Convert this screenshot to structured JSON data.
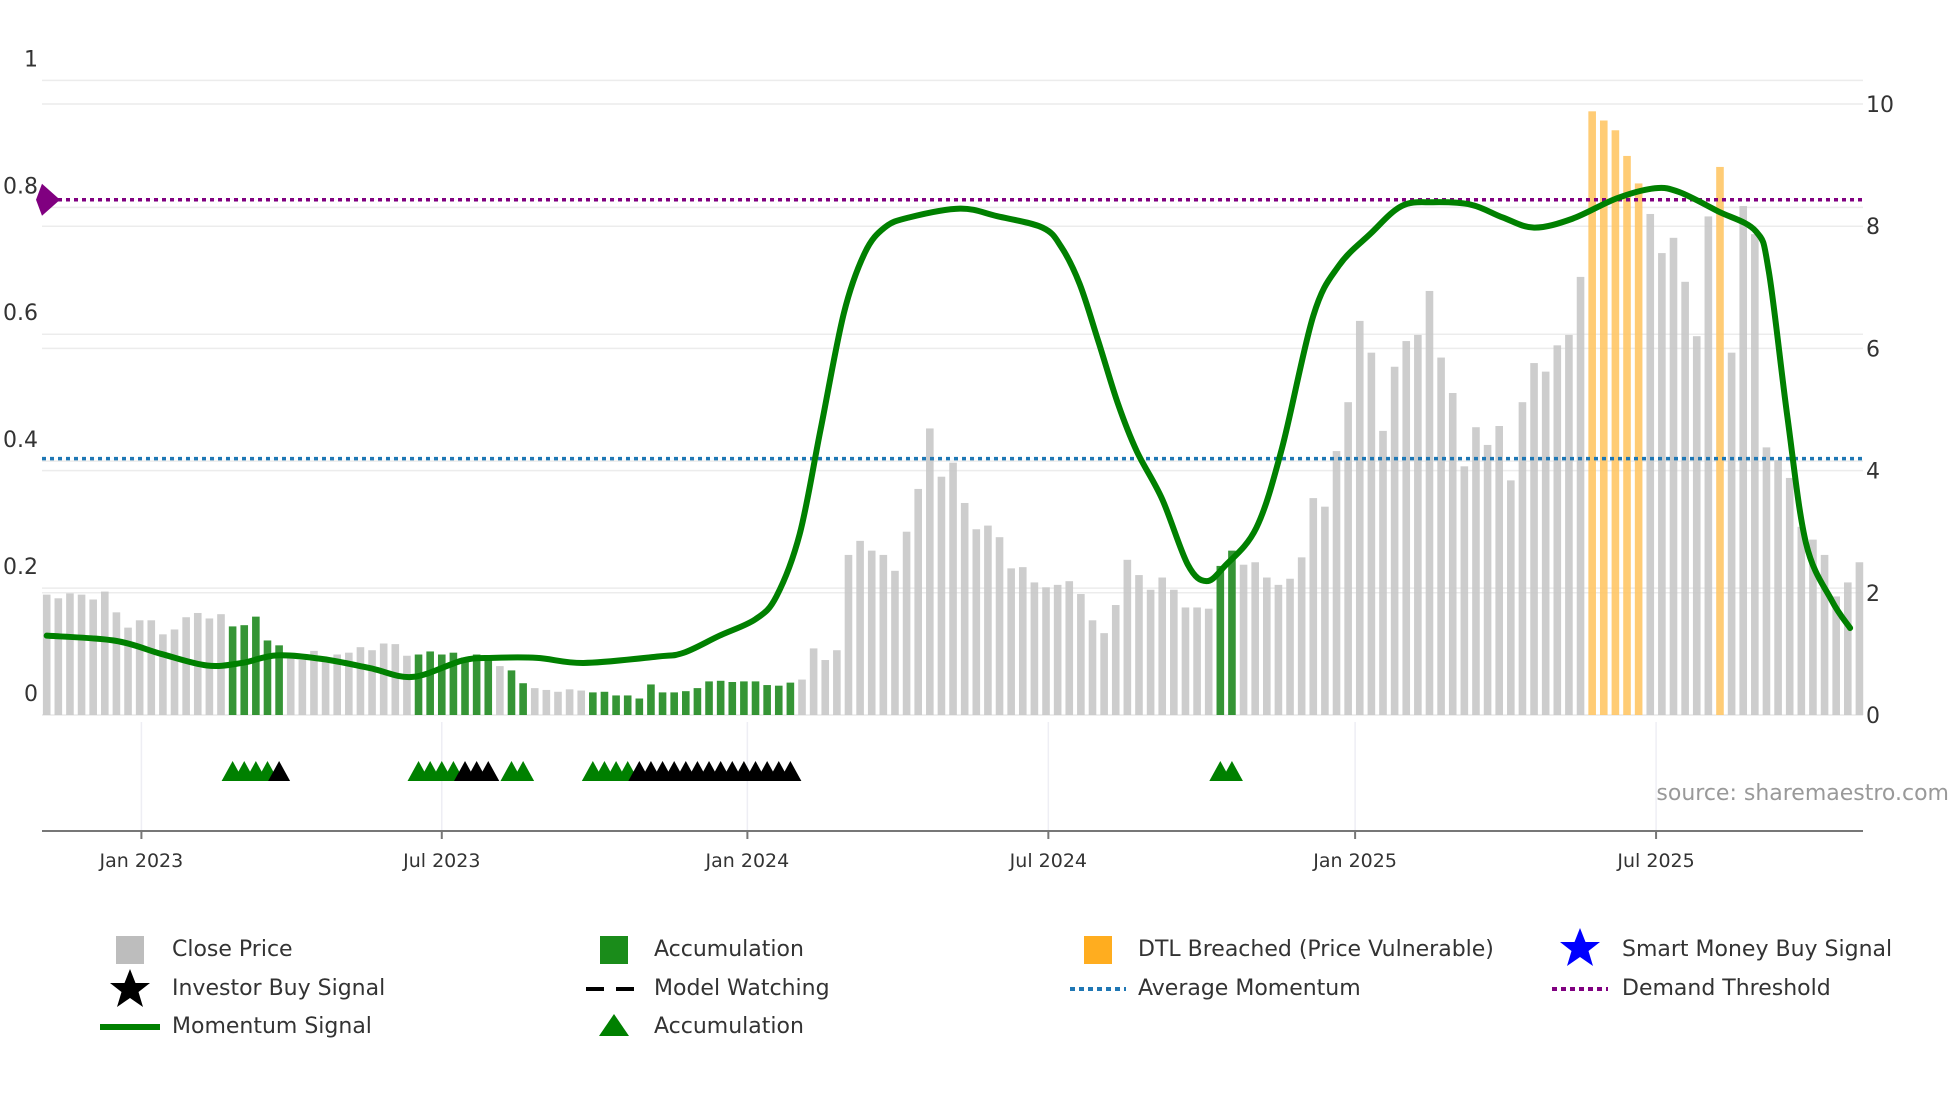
{
  "chart_data": {
    "type": "bar",
    "x_unit": "weekly bars, index 0 = week of 2022-11-07",
    "bars": {
      "name": "Close Price",
      "axis": "right",
      "values": [
        1.97,
        1.91,
        1.99,
        1.97,
        1.89,
        2.02,
        1.68,
        1.43,
        1.55,
        1.55,
        1.32,
        1.4,
        1.6,
        1.67,
        1.58,
        1.65,
        1.45,
        1.47,
        1.61,
        1.22,
        1.14,
        0.96,
        0.9,
        1.05,
        0.93,
        0.99,
        1.02,
        1.11,
        1.06,
        1.17,
        1.16,
        0.97,
        0.99,
        1.04,
        0.99,
        1.02,
        0.94,
        0.99,
        0.94,
        0.8,
        0.73,
        0.52,
        0.44,
        0.41,
        0.38,
        0.42,
        0.4,
        0.37,
        0.38,
        0.32,
        0.32,
        0.27,
        0.5,
        0.37,
        0.37,
        0.39,
        0.44,
        0.55,
        0.56,
        0.54,
        0.55,
        0.55,
        0.49,
        0.48,
        0.53,
        0.58,
        1.09,
        0.9,
        1.06,
        2.62,
        2.85,
        2.69,
        2.62,
        2.36,
        3.0,
        3.7,
        4.69,
        3.9,
        4.13,
        3.47,
        3.04,
        3.1,
        2.91,
        2.4,
        2.42,
        2.17,
        2.09,
        2.13,
        2.19,
        1.98,
        1.55,
        1.34,
        1.8,
        2.54,
        2.29,
        2.05,
        2.25,
        2.05,
        1.76,
        1.76,
        1.74,
        2.44,
        2.69,
        2.46,
        2.5,
        2.25,
        2.13,
        2.23,
        2.58,
        3.55,
        3.41,
        4.32,
        5.12,
        6.45,
        5.93,
        4.65,
        5.7,
        6.12,
        6.22,
        6.94,
        5.85,
        5.27,
        4.07,
        4.71,
        4.42,
        4.73,
        3.84,
        5.12,
        5.76,
        5.62,
        6.05,
        6.22,
        7.17,
        9.88,
        9.73,
        9.57,
        9.15,
        8.7,
        8.2,
        7.56,
        7.81,
        7.09,
        6.2,
        8.16,
        8.97,
        5.93,
        8.33,
        7.87,
        4.38,
        4.17,
        3.88,
        3.08,
        2.87,
        2.62,
        1.94,
        2.17,
        2.5
      ],
      "accumulation_ranges": [
        [
          16,
          20
        ],
        [
          32,
          38
        ],
        [
          40,
          41
        ],
        [
          47,
          64
        ],
        [
          101,
          102
        ]
      ],
      "dtl_breached_ranges": [
        [
          133,
          137
        ],
        [
          144,
          144
        ]
      ]
    },
    "momentum_line": {
      "name": "Momentum Signal",
      "axis": "left",
      "points": [
        [
          0,
          0.125
        ],
        [
          5.9,
          0.117
        ],
        [
          9.9,
          0.096
        ],
        [
          13.8,
          0.078
        ],
        [
          16.8,
          0.082
        ],
        [
          19.8,
          0.094
        ],
        [
          23.8,
          0.088
        ],
        [
          27.8,
          0.074
        ],
        [
          31.5,
          0.06
        ],
        [
          35.8,
          0.086
        ],
        [
          38.4,
          0.09
        ],
        [
          42.2,
          0.09
        ],
        [
          46.2,
          0.082
        ],
        [
          52.5,
          0.092
        ],
        [
          54.8,
          0.098
        ],
        [
          57.9,
          0.125
        ],
        [
          61,
          0.151
        ],
        [
          62.8,
          0.187
        ],
        [
          64.8,
          0.285
        ],
        [
          66.6,
          0.45
        ],
        [
          68.6,
          0.633
        ],
        [
          70.4,
          0.728
        ],
        [
          72.1,
          0.768
        ],
        [
          74.2,
          0.784
        ],
        [
          78.6,
          0.798
        ],
        [
          81.8,
          0.786
        ],
        [
          85.7,
          0.768
        ],
        [
          87.3,
          0.738
        ],
        [
          88.9,
          0.679
        ],
        [
          90.5,
          0.589
        ],
        [
          92.2,
          0.49
        ],
        [
          93.8,
          0.416
        ],
        [
          96,
          0.34
        ],
        [
          98.2,
          0.237
        ],
        [
          99.8,
          0.211
        ],
        [
          101.4,
          0.235
        ],
        [
          104.1,
          0.295
        ],
        [
          106.3,
          0.42
        ],
        [
          109,
          0.629
        ],
        [
          111.2,
          0.708
        ],
        [
          113.9,
          0.758
        ],
        [
          116.6,
          0.802
        ],
        [
          119.3,
          0.808
        ],
        [
          122.6,
          0.804
        ],
        [
          125.3,
          0.784
        ],
        [
          128,
          0.768
        ],
        [
          131.3,
          0.782
        ],
        [
          135.1,
          0.814
        ],
        [
          138.4,
          0.83
        ],
        [
          140.5,
          0.824
        ],
        [
          143.8,
          0.794
        ],
        [
          147.1,
          0.762
        ],
        [
          148.2,
          0.699
        ],
        [
          149.8,
          0.47
        ],
        [
          151.4,
          0.271
        ],
        [
          153.6,
          0.181
        ],
        [
          155.2,
          0.137
        ]
      ]
    },
    "accumulation_triangles": [
      16,
      17,
      18,
      19,
      32,
      33,
      34,
      35,
      40,
      41,
      47,
      48,
      49,
      50,
      101,
      102
    ],
    "investor_buy_triangles": [
      20,
      36,
      37,
      38,
      51,
      52,
      53,
      54,
      55,
      56,
      57,
      58,
      59,
      60,
      61,
      62,
      63,
      64
    ],
    "demand_threshold": 0.812,
    "average_momentum": 0.404,
    "left_axis": {
      "ylim": [
        0,
        1
      ],
      "ticks": [
        "0",
        "0.2",
        "0.4",
        "0.6",
        "0.8",
        "1"
      ],
      "tick_values": [
        0,
        0.2,
        0.4,
        0.6,
        0.8,
        1
      ]
    },
    "right_axis": {
      "ylim": [
        0,
        10
      ],
      "ticks": [
        "0",
        "2",
        "4",
        "6",
        "8",
        "10"
      ],
      "tick_values": [
        0,
        2,
        4,
        6,
        8,
        10
      ]
    },
    "x_ticks": [
      {
        "label": "Jan 2023",
        "week": 8.15
      },
      {
        "label": "Jul 2023",
        "week": 34.0
      },
      {
        "label": "Jan 2024",
        "week": 60.3
      },
      {
        "label": "Jul 2024",
        "week": 86.2
      },
      {
        "label": "Jan 2025",
        "week": 112.6
      },
      {
        "label": "Jul 2025",
        "week": 138.5
      }
    ],
    "annotation": "source: sharemaestro.com",
    "legend_placement": "bottom",
    "colors": {
      "close": "#c8c8c8",
      "accumulation": "#2a8f2a",
      "dtl": "#ffc766",
      "momentum": "#008000",
      "average": "#1f77b4",
      "demand": "#800080",
      "smart_money": "#0000ff",
      "investor": "#000000"
    }
  },
  "legend": {
    "close_price": "Close Price",
    "accumulation_bar": "Accumulation",
    "dtl_breached": "DTL Breached (Price Vulnerable)",
    "smart_money": "Smart Money Buy Signal",
    "investor_buy": "Investor Buy Signal",
    "model_watching": "Model Watching",
    "average_momentum": "Average Momentum",
    "demand_threshold": "Demand Threshold",
    "momentum_signal": "Momentum Signal",
    "accumulation_marker": "Accumulation"
  }
}
